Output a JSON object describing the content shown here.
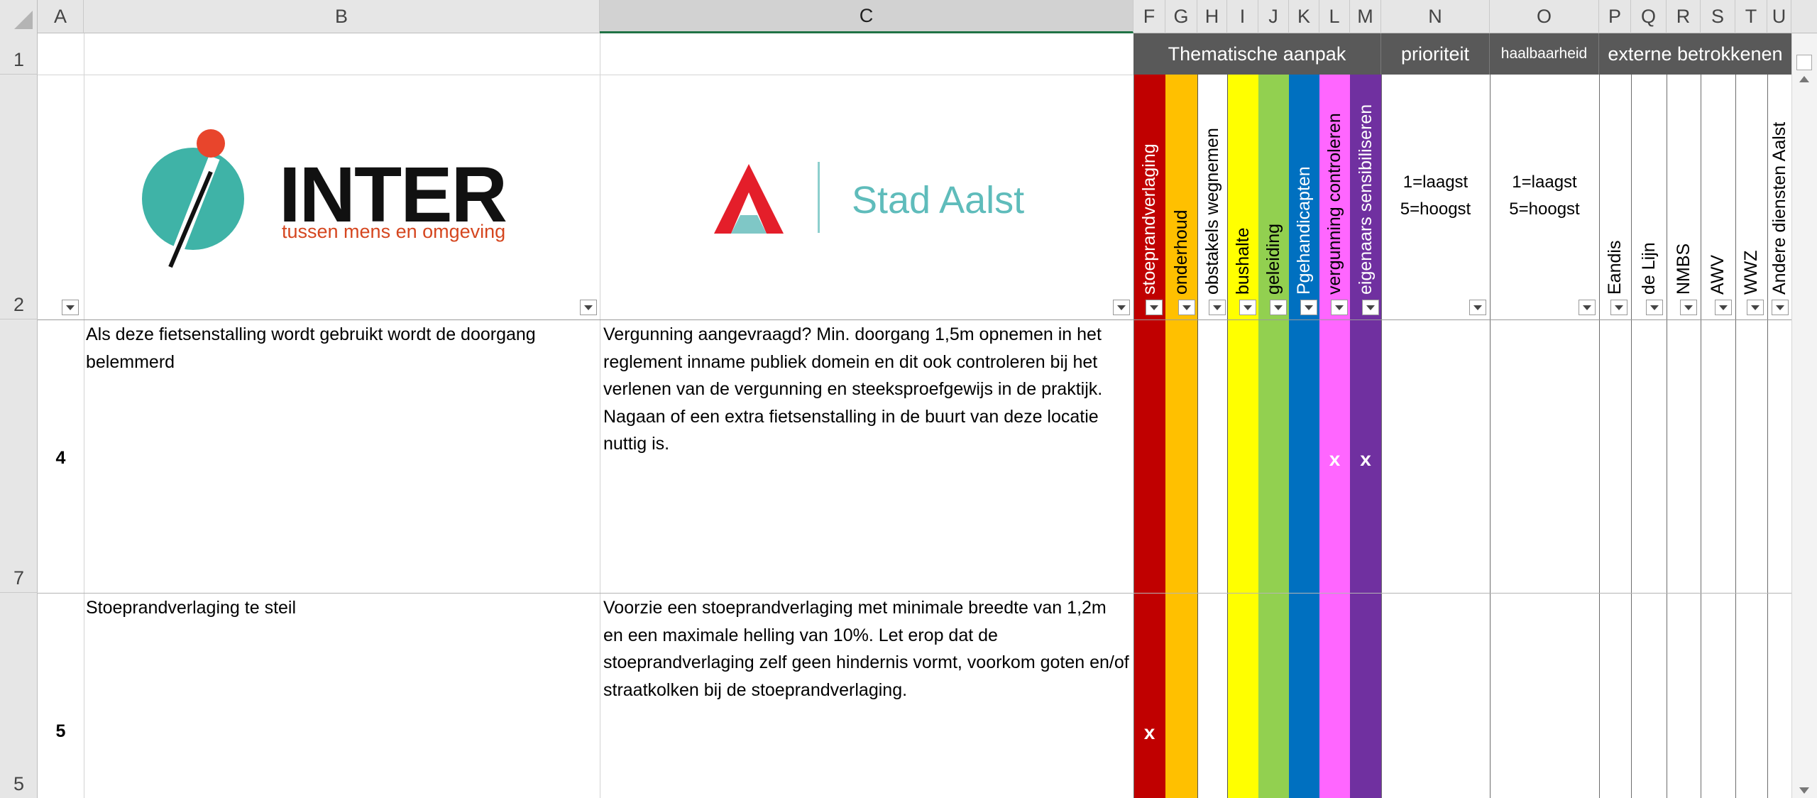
{
  "columns": {
    "A": "A",
    "B": "B",
    "C": "C",
    "F": "F",
    "G": "G",
    "H": "H",
    "I": "I",
    "J": "J",
    "K": "K",
    "L": "L",
    "M": "M",
    "N": "N",
    "O": "O",
    "P": "P",
    "Q": "Q",
    "R": "R",
    "S": "S",
    "T": "T",
    "U": "U"
  },
  "rows": {
    "r1": "1",
    "r2": "2",
    "r7": "7",
    "r5": "5"
  },
  "row_numbers_in_col_a": {
    "r7": "4",
    "r5": "5"
  },
  "group_headers": {
    "thematische": "Thematische aanpak",
    "prioriteit": "prioriteit",
    "haalbaarheid": "haalbaarheid",
    "externe": "externe betrokkenen"
  },
  "logos": {
    "inter_name": "INTER",
    "inter_tagline": "tussen mens en omgeving",
    "stad_name": "Stad Aalst"
  },
  "categories": [
    {
      "label": "stoeprandverlaging",
      "color": "#c00000"
    },
    {
      "label": "onderhoud",
      "color": "#ffc000"
    },
    {
      "label": "obstakels wegnemen",
      "color": "#ffffff"
    },
    {
      "label": "bushalte",
      "color": "#ffff00"
    },
    {
      "label": "geleiding",
      "color": "#92d050"
    },
    {
      "label": "Pgehandicapten",
      "color": "#0070c0"
    },
    {
      "label": "vergunning controleren",
      "color": "#ff66ff"
    },
    {
      "label": "eigenaars sensibiliseren",
      "color": "#7030a0"
    }
  ],
  "scales": {
    "prioriteit": "1=laagst\n5=hoogst",
    "haalbaarheid": "1=laagst\n5=hoogst"
  },
  "externe_columns": [
    "Eandis",
    "de Lijn",
    "NMBS",
    "AWV",
    "WWZ",
    "Andere diensten Aalst"
  ],
  "data_rows": [
    {
      "problem": "Als deze fietsenstalling wordt gebruikt wordt de doorgang belemmerd",
      "solution": " Vergunning aangevraagd? Min. doorgang 1,5m opnemen in het reglement inname publiek domein en dit ook controleren bij het verlenen van de vergunning en steeksproefgewijs in de praktijk.\nNagaan of een extra fietsenstalling in de buurt van deze locatie nuttig is.",
      "marks": {
        "vergunning": "x",
        "eigenaars": "x"
      }
    },
    {
      "problem": "Stoeprandverlaging te steil",
      "solution": "Voorzie een stoeprandverlaging met minimale breedte van 1,2m en een maximale helling van 10%. Let erop dat de stoeprandverlaging zelf geen hindernis vormt, voorkom goten en/of straatkolken bij de stoeprandverlaging.",
      "marks": {
        "stoeprand": "x"
      }
    }
  ]
}
